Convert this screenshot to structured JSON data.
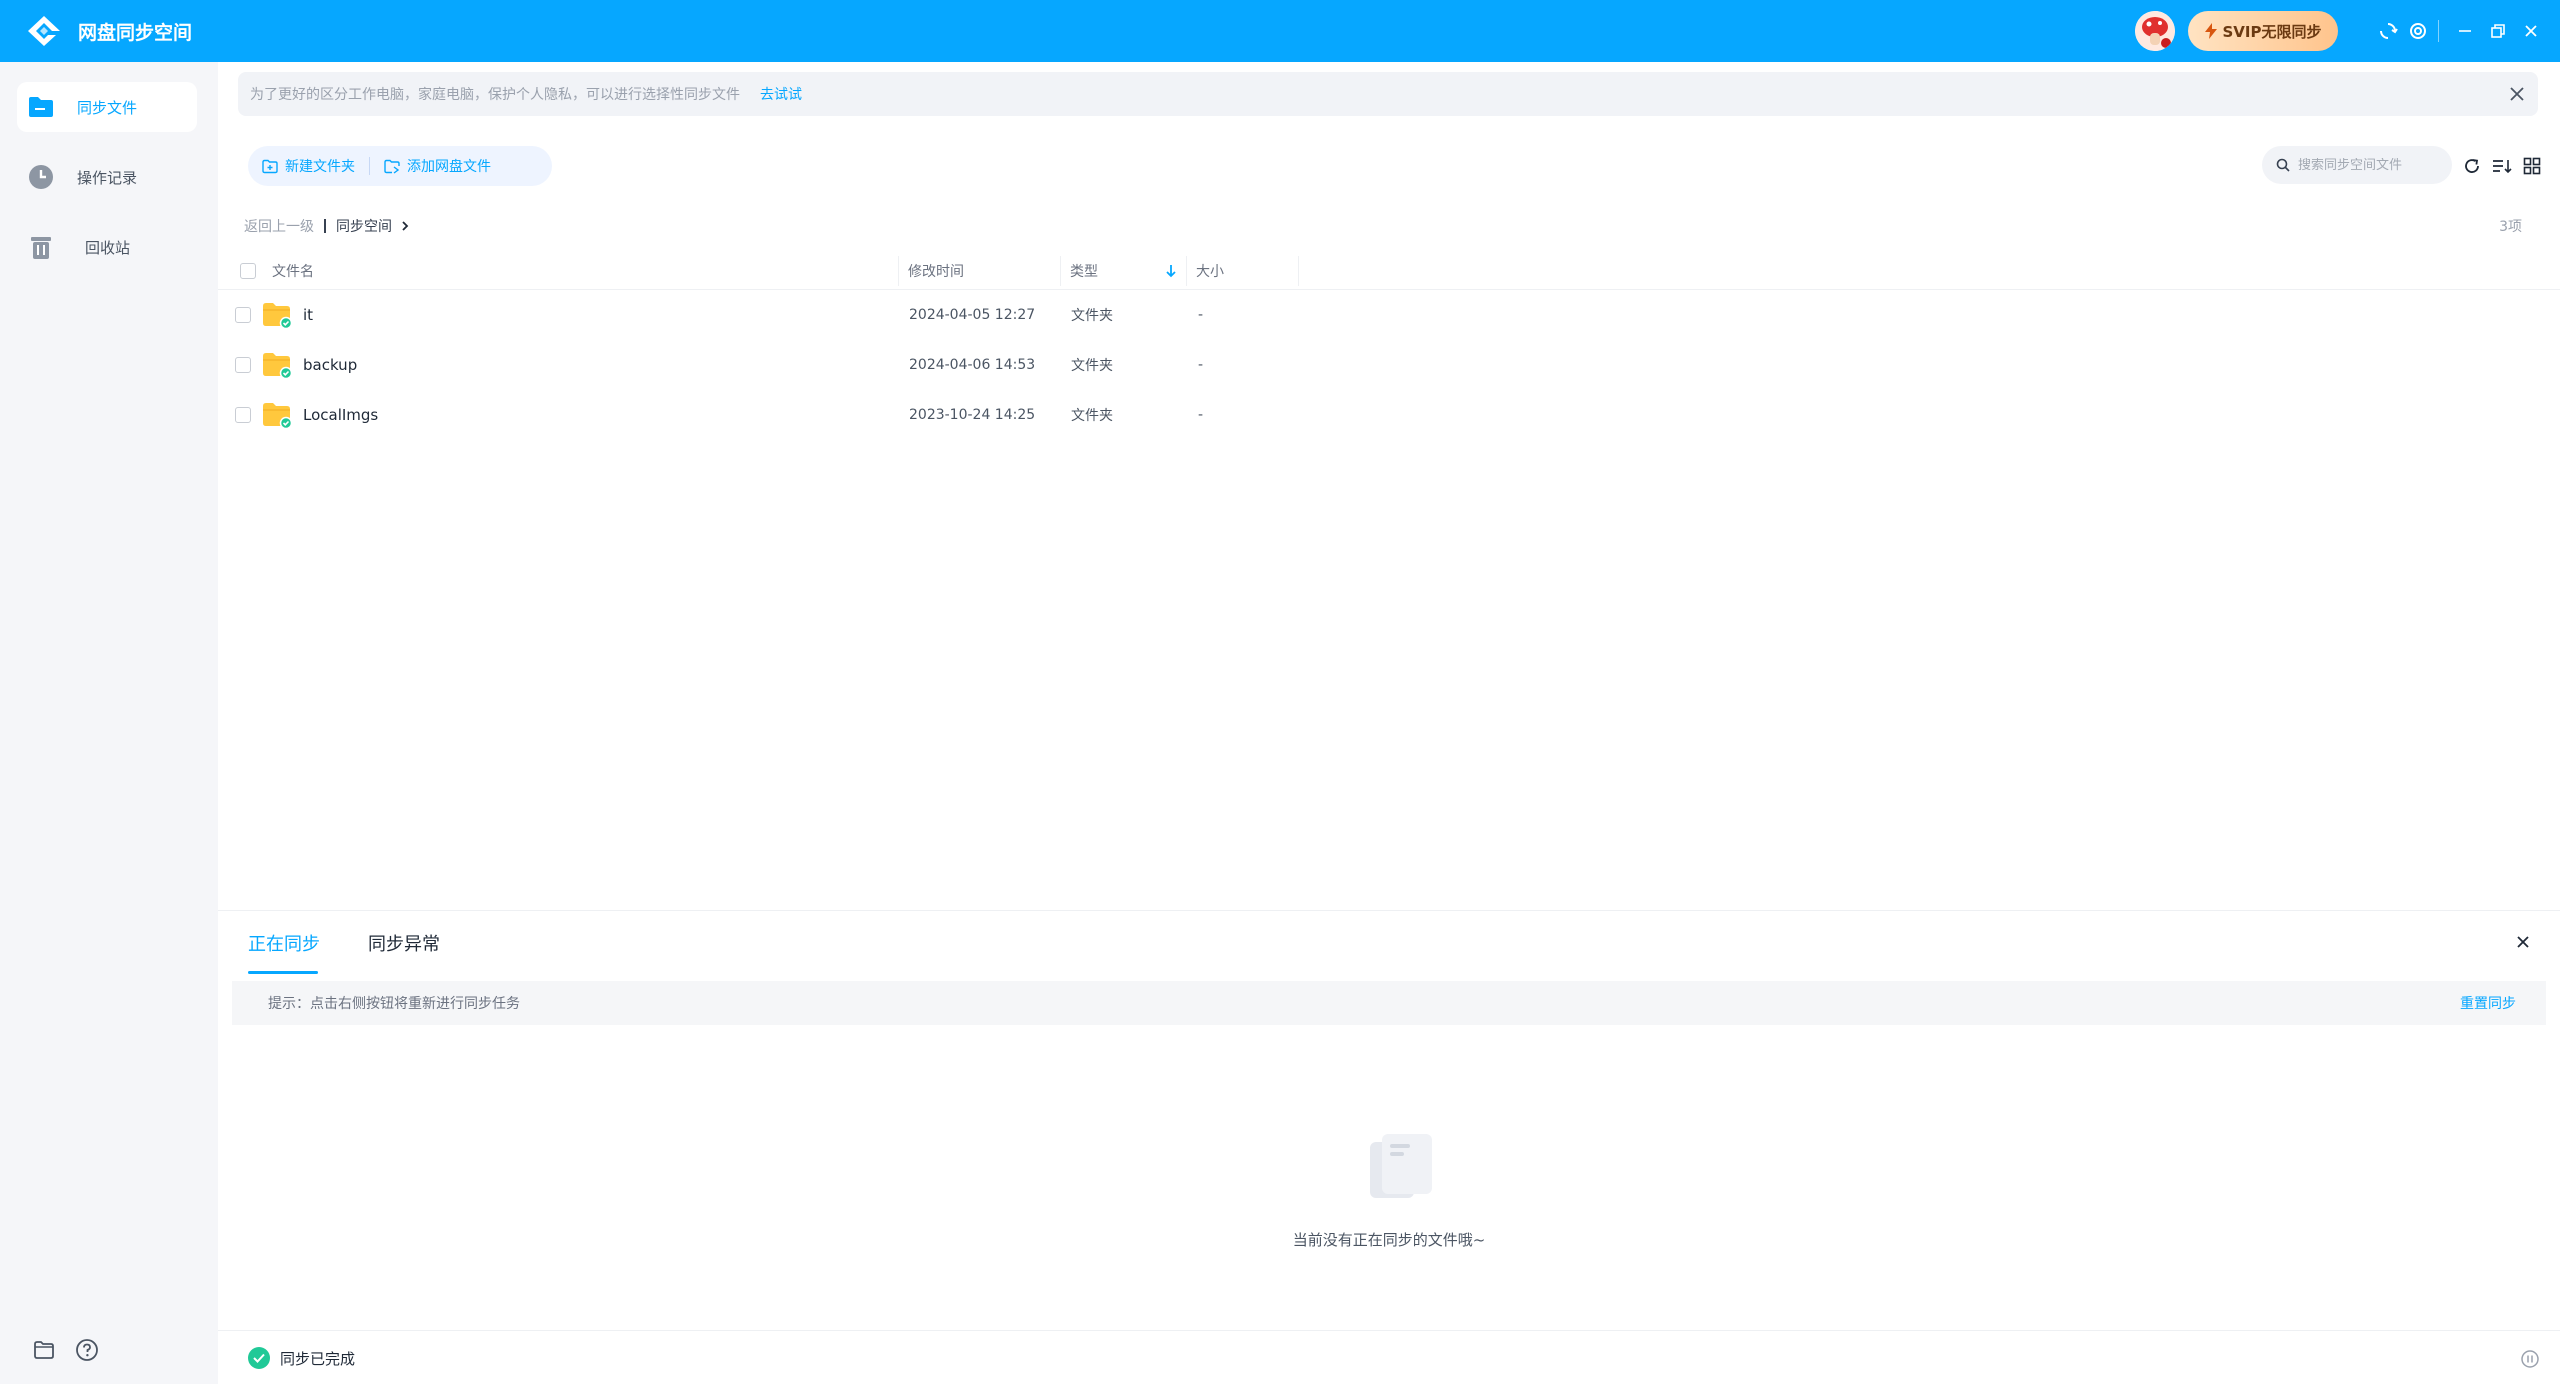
{
  "titlebar": {
    "app_title": "网盘同步空间",
    "svip_label": "SVIP无限同步"
  },
  "sidebar": {
    "items": [
      {
        "label": "同步文件",
        "icon": "folder-sync-icon",
        "active": true
      },
      {
        "label": "操作记录",
        "icon": "clock-icon",
        "active": false
      },
      {
        "label": "回收站",
        "icon": "trash-icon",
        "active": false
      }
    ],
    "bottom": [
      {
        "icon": "folder-icon"
      },
      {
        "icon": "help-icon"
      }
    ]
  },
  "banner": {
    "text": "为了更好的区分工作电脑，家庭电脑，保护个人隐私，可以进行选择性同步文件",
    "link": "去试试"
  },
  "toolbar": {
    "new_folder": "新建文件夹",
    "add_cloud_file": "添加网盘文件",
    "search_placeholder": "搜索同步空间文件"
  },
  "breadcrumb": {
    "back": "返回上一级",
    "current": "同步空间",
    "count": "3项"
  },
  "table": {
    "headers": {
      "name": "文件名",
      "modified": "修改时间",
      "type": "类型",
      "size": "大小"
    },
    "rows": [
      {
        "name": "it",
        "modified": "2024-04-05 12:27",
        "type": "文件夹",
        "size": "-"
      },
      {
        "name": "backup",
        "modified": "2024-04-06 14:53",
        "type": "文件夹",
        "size": "-"
      },
      {
        "name": "LocalImgs",
        "modified": "2023-10-24 14:25",
        "type": "文件夹",
        "size": "-"
      }
    ]
  },
  "panel": {
    "tab_syncing": "正在同步",
    "tab_errors": "同步异常",
    "tip": "提示：点击右侧按钮将重新进行同步任务",
    "resync": "重置同步",
    "empty_text": "当前没有正在同步的文件哦~"
  },
  "statusbar": {
    "text": "同步已完成"
  },
  "colors": {
    "accent": "#06a7ff",
    "success": "#20c997",
    "folder": "#ffc83d"
  }
}
